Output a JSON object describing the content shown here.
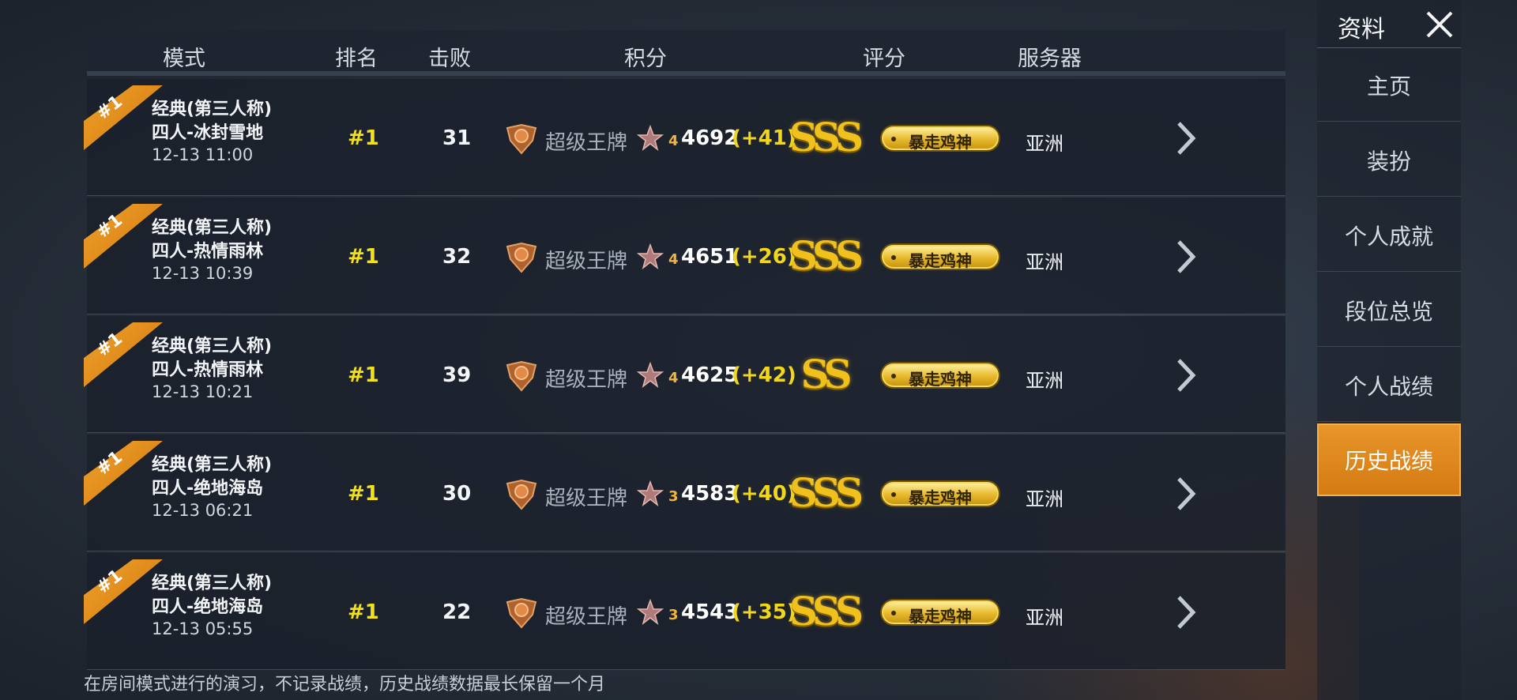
{
  "header": {
    "col_mode": "模式",
    "col_rank": "排名",
    "col_kills": "击败",
    "col_points": "积分",
    "col_rating": "评分",
    "col_server": "服务器"
  },
  "rows": [
    {
      "badge": "#1",
      "mode_line1": "经典(第三人称)",
      "mode_line2": "四人-冰封雪地",
      "time": "12-13 11:00",
      "rank": "#1",
      "kills": "31",
      "tier": "超级王牌",
      "star_level": "4",
      "score": "4692",
      "delta": "(+41)",
      "grade": "SSS",
      "title": "暴走鸡神",
      "server": "亚洲"
    },
    {
      "badge": "#1",
      "mode_line1": "经典(第三人称)",
      "mode_line2": "四人-热情雨林",
      "time": "12-13 10:39",
      "rank": "#1",
      "kills": "32",
      "tier": "超级王牌",
      "star_level": "4",
      "score": "4651",
      "delta": "(+26)",
      "grade": "SSS",
      "title": "暴走鸡神",
      "server": "亚洲"
    },
    {
      "badge": "#1",
      "mode_line1": "经典(第三人称)",
      "mode_line2": "四人-热情雨林",
      "time": "12-13 10:21",
      "rank": "#1",
      "kills": "39",
      "tier": "超级王牌",
      "star_level": "4",
      "score": "4625",
      "delta": "(+42)",
      "grade": "SS",
      "title": "暴走鸡神",
      "server": "亚洲"
    },
    {
      "badge": "#1",
      "mode_line1": "经典(第三人称)",
      "mode_line2": "四人-绝地海岛",
      "time": "12-13 06:21",
      "rank": "#1",
      "kills": "30",
      "tier": "超级王牌",
      "star_level": "3",
      "score": "4583",
      "delta": "(+40)",
      "grade": "SSS",
      "title": "暴走鸡神",
      "server": "亚洲"
    },
    {
      "badge": "#1",
      "mode_line1": "经典(第三人称)",
      "mode_line2": "四人-绝地海岛",
      "time": "12-13 05:55",
      "rank": "#1",
      "kills": "22",
      "tier": "超级王牌",
      "star_level": "3",
      "score": "4543",
      "delta": "(+35)",
      "grade": "SSS",
      "title": "暴走鸡神",
      "server": "亚洲"
    }
  ],
  "footnote": "在房间模式进行的演习，不记录战绩，历史战绩数据最长保留一个月",
  "sidebar": {
    "title": "资料",
    "items": [
      {
        "label": "主页"
      },
      {
        "label": "装扮"
      },
      {
        "label": "个人成就"
      },
      {
        "label": "段位总览"
      },
      {
        "label": "个人战绩"
      },
      {
        "label": "历史战绩"
      }
    ],
    "active_index": 5
  },
  "icons": {
    "close": "close-icon",
    "chevron": "chevron-right-icon",
    "tier": "ace-tier-icon",
    "star": "star-icon"
  },
  "colors": {
    "accent_orange": "#e08a1e",
    "rank_yellow": "#f2e01a",
    "grade_gold": "#f0c01c"
  }
}
